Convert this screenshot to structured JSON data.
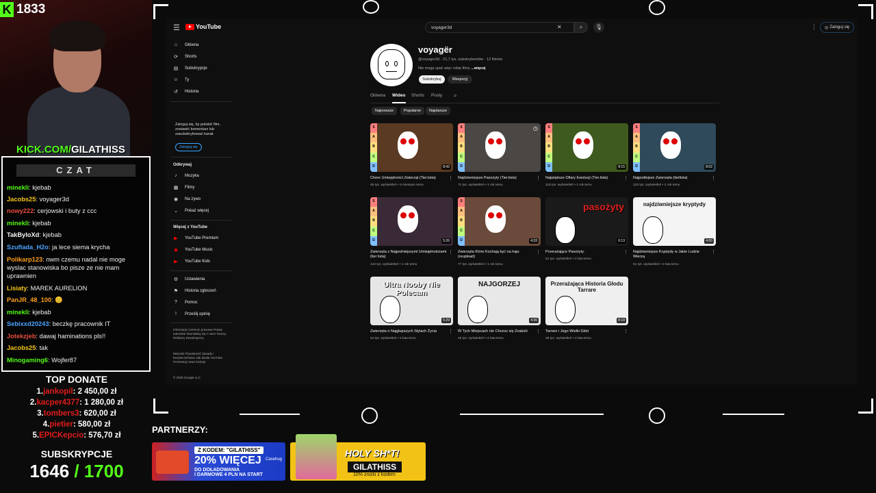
{
  "stream": {
    "viewers": "1833",
    "kick_url_green": "KICK.COM/",
    "kick_url_white": "GILATHISS",
    "chat_title": "CZAT",
    "chat": [
      {
        "user": "minekli",
        "color": "#53fc18",
        "msg": "kjebab"
      },
      {
        "user": "Jacobs25",
        "color": "#f5c518",
        "msg": "voyager3d"
      },
      {
        "user": "nowy222",
        "color": "#e84c3d",
        "msg": "cerjowski i buty z ccc"
      },
      {
        "user": "minekli",
        "color": "#53fc18",
        "msg": "kjebab"
      },
      {
        "user": "TakByloXd",
        "color": "#f5f5f5",
        "msg": "kjebab"
      },
      {
        "user": "Szuflada_H2o",
        "color": "#4aa3ff",
        "msg": "ja lece siema krycha"
      },
      {
        "user": "Polikarp123",
        "color": "#ff9f1c",
        "msg": "nwm czemu nadal nie moge wyslac stanowiska bo pisze ze nie mam uprawnien"
      },
      {
        "user": "Lisiaty",
        "color": "#f5c518",
        "msg": "MAREK AURELION"
      },
      {
        "user": "PanJR_48_100",
        "color": "#ff9f1c",
        "msg": "😊"
      },
      {
        "user": "minekli",
        "color": "#53fc18",
        "msg": "kjebab"
      },
      {
        "user": "Sebixxd20243",
        "color": "#4aa3ff",
        "msg": "beczkę pracownik IT"
      },
      {
        "user": "Jotekzjeb",
        "color": "#e84c3d",
        "msg": "dawaj haminations pls!!"
      },
      {
        "user": "Jacobs25",
        "color": "#f5c518",
        "msg": "tak"
      },
      {
        "user": "Minogaming6",
        "color": "#53fc18",
        "msg": "Wojfer87"
      }
    ],
    "top_donate_title": "TOP DONATE",
    "donations": [
      {
        "rank": "1.",
        "user": "jankopil",
        "amount": ": 2 450,00 zł"
      },
      {
        "rank": "2.",
        "user": "kacper4377",
        "amount": ": 1 280,00 zł"
      },
      {
        "rank": "3.",
        "user": "tombers3",
        "amount": ": 620,00 zł"
      },
      {
        "rank": "4.",
        "user": "pietier",
        "amount": ": 580,00 zł"
      },
      {
        "rank": "5.",
        "user": "EPICKepcio",
        "amount": ": 576,70 zł"
      }
    ],
    "subs_title": "SUBSKRYPCJE",
    "subs_current": "1646",
    "subs_goal": " / 1700",
    "partners_label": "PARTNERZY:",
    "banner1": {
      "tag": "Z KODEM: \"GILATHISS\"",
      "big": "20% WIĘCEJ",
      "line2": "DO DOŁADOWANIA",
      "line3": "I DARMOWE 4 PLN NA START",
      "brand": "Casehug"
    },
    "banner2": {
      "headline": "HOLY SH*T!",
      "code": "GILATHISS",
      "sub": "10% zniżki z kodem"
    }
  },
  "youtube": {
    "logo": "YouTube",
    "search_value": "voyager3d",
    "signin": "Zaloguj się",
    "sidebar": {
      "main": [
        {
          "icon": "home-icon",
          "glyph": "⌂",
          "label": "Główna"
        },
        {
          "icon": "shorts-icon",
          "glyph": "⟳",
          "label": "Shorts"
        },
        {
          "icon": "subscriptions-icon",
          "glyph": "▤",
          "label": "Subskrypcje"
        },
        {
          "icon": "you-icon",
          "glyph": "☺",
          "label": "Ty"
        },
        {
          "icon": "history-icon",
          "glyph": "↺",
          "label": "Historia"
        }
      ],
      "signin_msg": "Zaloguj się, by polubić film, zostawić komentarz lub zasubskrybować kanał.",
      "signin_btn": "Zaloguj się",
      "explore_title": "Odkrywaj",
      "explore": [
        {
          "icon": "music-icon",
          "glyph": "♪",
          "label": "Muzyka"
        },
        {
          "icon": "film-icon",
          "glyph": "▦",
          "label": "Filmy"
        },
        {
          "icon": "live-icon",
          "glyph": "◉",
          "label": "Na żywo"
        },
        {
          "icon": "chevron-down-icon",
          "glyph": "⌄",
          "label": "Pokaż więcej"
        }
      ],
      "more_title": "Więcej z YouTube",
      "more": [
        {
          "icon": "yt-premium-icon",
          "glyph": "▶",
          "label": "YouTube Premium"
        },
        {
          "icon": "yt-music-icon",
          "glyph": "◉",
          "label": "YouTube Music"
        },
        {
          "icon": "yt-kids-icon",
          "glyph": "▶",
          "label": "YouTube Kids"
        }
      ],
      "settings": [
        {
          "icon": "gear-icon",
          "glyph": "⚙",
          "label": "Ustawienia"
        },
        {
          "icon": "flag-icon",
          "glyph": "⚑",
          "label": "Historia zgłoszeń"
        },
        {
          "icon": "help-icon",
          "glyph": "?",
          "label": "Pomoc"
        },
        {
          "icon": "feedback-icon",
          "glyph": "!",
          "label": "Prześlij opinię"
        }
      ],
      "footer1": "Informacje  Centrum prasowe  Prawa autorskie  Skontaktuj się z nami  Twórcy  Reklamy  Deweloperzy",
      "footer2": "Warunki  Prywatność  Zasady i bezpieczeństwo  Jak działa YouTube  Przetestuj nowe funkcje",
      "copyright": "© 2025 Google LLC"
    },
    "channel": {
      "name": "voyagër",
      "meta": "@voyager3d · 21,7 tys. subskrybentów · 12 filmów",
      "desc": "Nie mogę spać więc robię filmy ",
      "desc_more": "...więcej",
      "subscribe": "Subskrybuj",
      "support": "Wesprzyj",
      "tabs": [
        "Główna",
        "Wideo",
        "Shorts",
        "Posty"
      ],
      "active_tab": "Wideo",
      "chips": [
        "Najnowsze",
        "Popularne",
        "Najstarsze"
      ]
    },
    "videos": [
      {
        "title": "Chore Umiejętności Zwierząt (Tier.lista)",
        "meta": "46 tys. wyświetleń • 3 miesiące temu",
        "duration": "8:42",
        "bg": "#5a3a22",
        "thumb_text": ""
      },
      {
        "title": "Najdziwniejsze Pasożyty (Tier.lista)",
        "meta": "71 tys. wyświetleń • 1 rok temu",
        "duration": "",
        "bg": "#4a4744",
        "thumb_text": ""
      },
      {
        "title": "Największe Ofiary Ewolucji (Tier.lista)",
        "meta": "118 tys. wyświetleń • 1 rok temu",
        "duration": "8:15",
        "bg": "#3f5a1e",
        "thumb_text": ""
      },
      {
        "title": "Najpodlejsze Zwierzęta (tierlista)",
        "meta": "133 tys. wyświetleń • 1 rok temu",
        "duration": "8:02",
        "bg": "#2f4a5a",
        "thumb_text": ""
      },
      {
        "title": "Zwierzęta z Najpoźniejszymi Umiejętnościami (tier lista)",
        "meta": "142 tys. wyświetleń • 1 rok temu",
        "duration": "5:26",
        "bg": "#3a2a38",
        "thumb_text": ""
      },
      {
        "title": "Zwierzęta Które Kochają być na haju (reupload)",
        "meta": "77 tys. wyświetleń • 1 rok temu",
        "duration": "4:33",
        "bg": "#6a4a3a",
        "thumb_text": ""
      },
      {
        "title": "Przerażające Pasożyty.",
        "meta": "61 tys. wyświetleń • 2 lata temu",
        "duration": "6:13",
        "bg": "#1a1a1a",
        "thumb_text": "pasożyty"
      },
      {
        "title": "Najdziwniejsze Kryptydy w Jakie Ludzie Wierzą",
        "meta": "51 tys. wyświetleń • 2 lata temu",
        "duration": "4:00",
        "bg": "#f4f4f4",
        "thumb_text": "najdziwniejsze kryptydy"
      },
      {
        "title": "Zwierzęta o Najgłupszych Stylach Życia",
        "meta": "64 tys. wyświetleń • 2 lata temu",
        "duration": "5:29",
        "bg": "#e6e6e6",
        "thumb_text": "Ultra Nooby Nie Polecam"
      },
      {
        "title": "W Tych Miejscach nie Chcesz się Znaleźć",
        "meta": "45 tys. wyświetleń • 2 lata temu",
        "duration": "4:36",
        "bg": "#e8e8e8",
        "thumb_text": "NAJGORZEJ"
      },
      {
        "title": "Tarrare i Jego Wielki Głód",
        "meta": "35 tys. wyświetleń • 2 lata temu",
        "duration": "8:18",
        "bg": "#efefef",
        "thumb_text": "Przerażająca Historia Głodu Tarrare"
      }
    ]
  }
}
